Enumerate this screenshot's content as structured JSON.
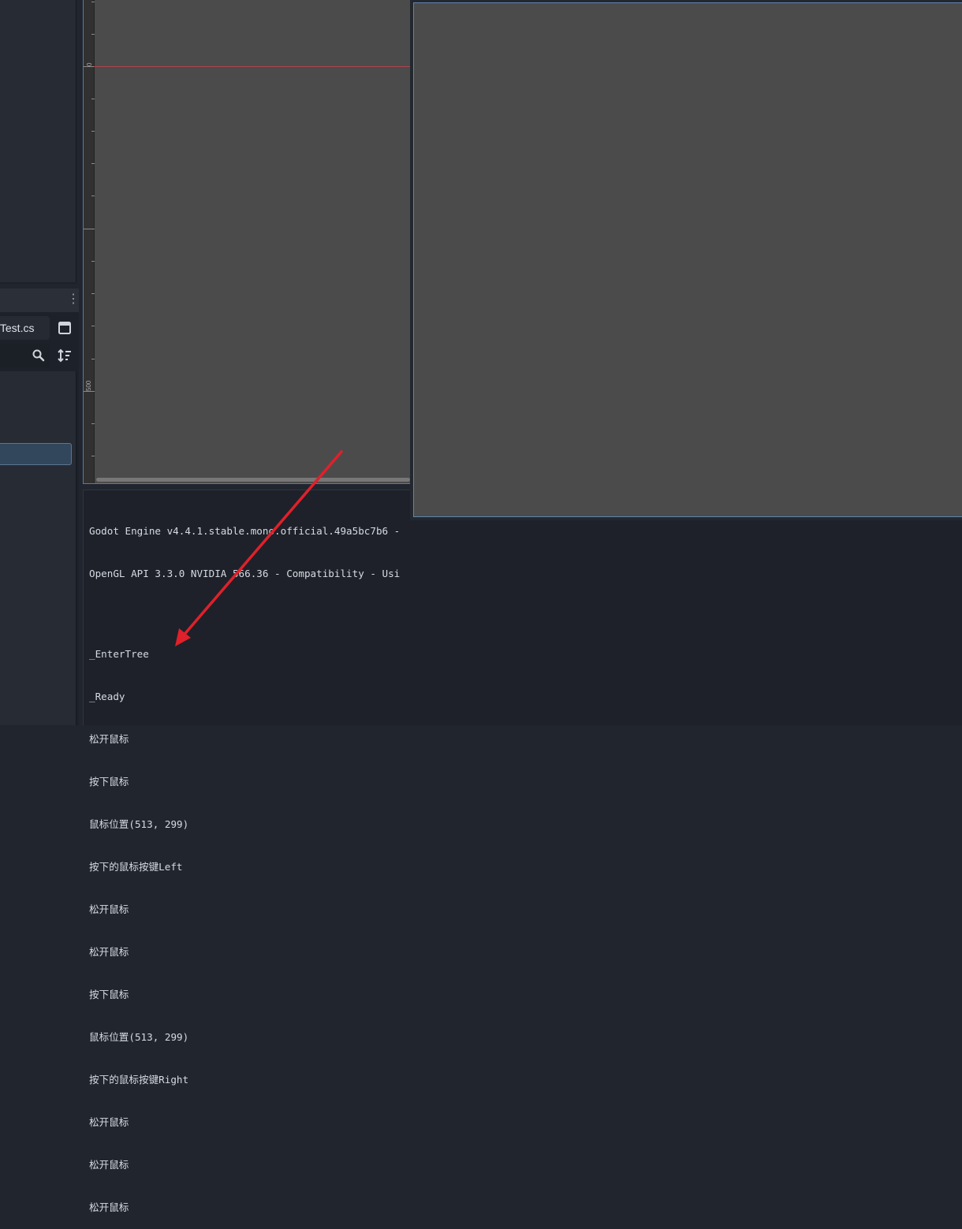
{
  "left_dock": {
    "script_tab_label": "tTest.cs",
    "icons": [
      "window-icon",
      "search-icon",
      "sort-icon",
      "more-vertical-icon"
    ]
  },
  "viewport": {
    "ruler_labels": [
      "0",
      "500"
    ]
  },
  "output": {
    "lines": [
      "Godot Engine v4.4.1.stable.mono.official.49a5bc7b6 -",
      "OpenGL API 3.3.0 NVIDIA 566.36 - Compatibility - Usi",
      "_EnterTree",
      "_Ready",
      "松开鼠标",
      "按下鼠标",
      "鼠标位置(513, 299)",
      "按下的鼠标按键Left",
      "松开鼠标",
      "松开鼠标",
      "按下鼠标",
      "鼠标位置(513, 299)",
      "按下的鼠标按键Right",
      "松开鼠标",
      "松开鼠标",
      "松开鼠标"
    ]
  },
  "colors": {
    "accent_border": "#5b7a9c",
    "annotation_arrow": "#e0202a",
    "origin_line": "#b0434d"
  }
}
